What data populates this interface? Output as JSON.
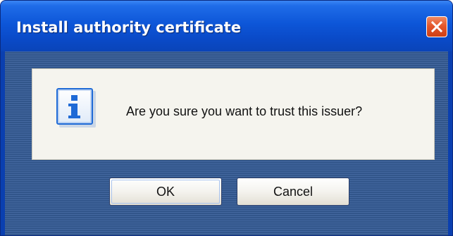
{
  "window": {
    "title": "Install authority certificate"
  },
  "dialog": {
    "icon": "information-icon",
    "message": "Are you sure you want to trust this issuer?"
  },
  "buttons": {
    "ok_label": "OK",
    "cancel_label": "Cancel",
    "close_icon": "close-icon"
  },
  "colors": {
    "titlebar": "#0d56d8",
    "close_button": "#e4572c",
    "client_background": "#3a5f95",
    "message_panel": "#f5f4ee",
    "info_icon_accent": "#1f6ad6"
  }
}
